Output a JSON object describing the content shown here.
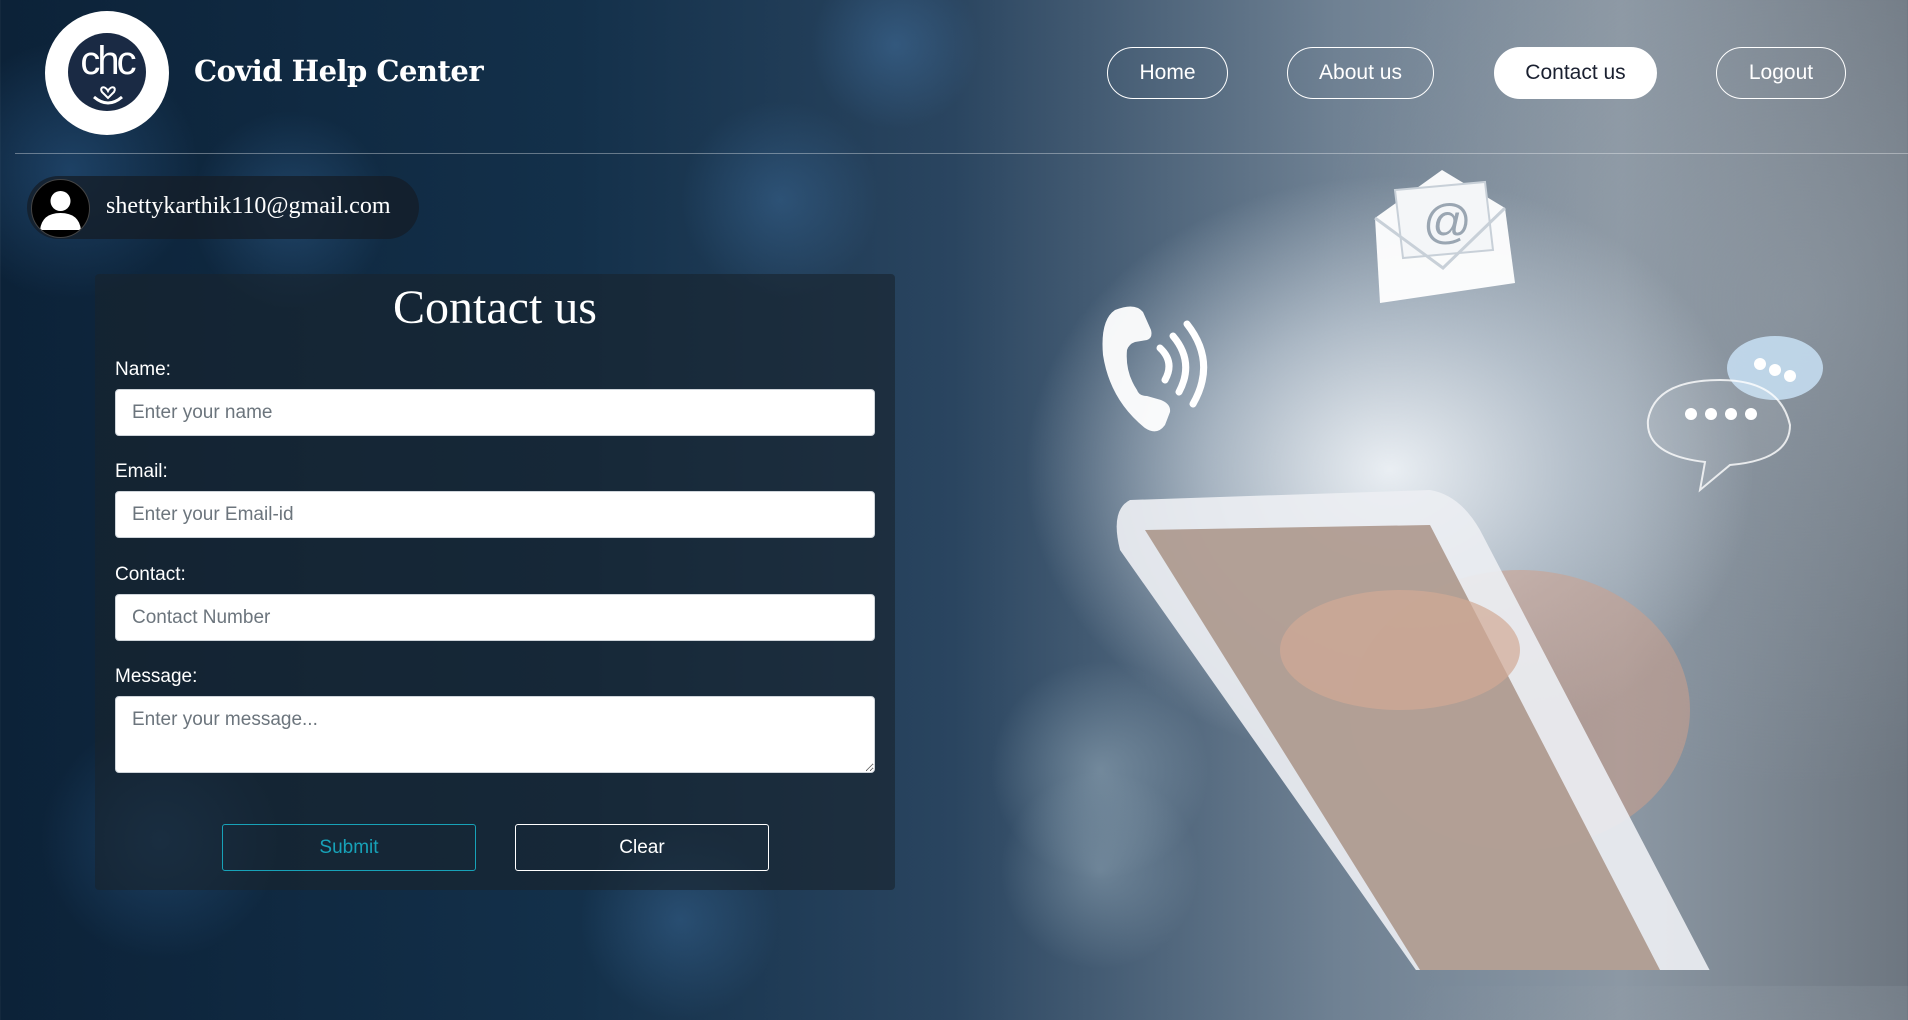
{
  "header": {
    "logo_text": "chc",
    "site_title": "Covid Help Center",
    "nav": [
      {
        "label": "Home",
        "active": false
      },
      {
        "label": "About us",
        "active": false
      },
      {
        "label": "Contact us",
        "active": true
      },
      {
        "label": "Logout",
        "active": false
      }
    ]
  },
  "user": {
    "email": "shettykarthik110@gmail.com",
    "avatar_icon": "user-silhouette-icon"
  },
  "form": {
    "title": "Contact us",
    "fields": {
      "name": {
        "label": "Name:",
        "placeholder": "Enter your name",
        "value": ""
      },
      "email": {
        "label": "Email:",
        "placeholder": "Enter your Email-id",
        "value": ""
      },
      "contact": {
        "label": "Contact:",
        "placeholder": "Contact Number",
        "value": ""
      },
      "message": {
        "label": "Message:",
        "placeholder": "Enter your message...",
        "value": ""
      }
    },
    "submit_label": "Submit",
    "clear_label": "Clear"
  },
  "colors": {
    "accent": "#17a2b8",
    "active_nav_bg": "#ffffff",
    "panel_bg": "#1e2a36"
  },
  "illustration_icons": [
    "phone-call-icon",
    "email-envelope-icon",
    "chat-bubble-icon",
    "smartphone-hand-icon"
  ]
}
